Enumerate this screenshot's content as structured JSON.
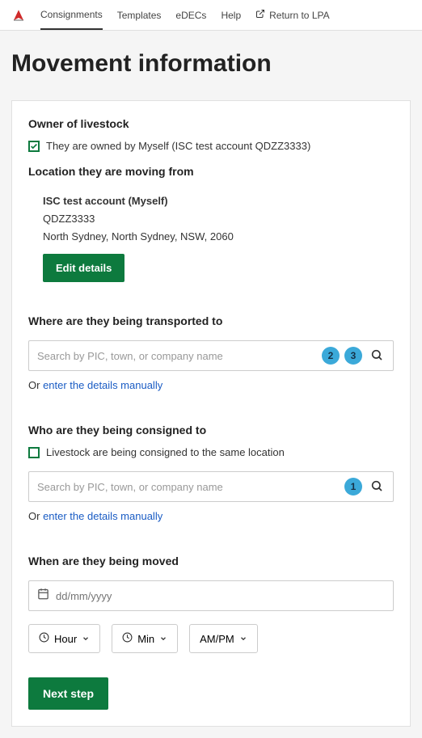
{
  "nav": {
    "consignments": "Consignments",
    "templates": "Templates",
    "edecs": "eDECs",
    "help": "Help",
    "return_lpa": "Return to LPA"
  },
  "page_title": "Movement information",
  "owner": {
    "heading": "Owner of livestock",
    "checkbox_label": "They are owned by Myself (ISC test account QDZZ3333)"
  },
  "moving_from": {
    "heading": "Location they are moving from",
    "account": "ISC test account (Myself)",
    "pic": "QDZZ3333",
    "address": "North Sydney, North Sydney, NSW, 2060",
    "edit_btn": "Edit details"
  },
  "transported_to": {
    "heading": "Where are they being transported to",
    "placeholder": "Search by PIC, town, or company name",
    "badge2": "2",
    "badge3": "3",
    "or_text": "Or ",
    "link": "enter the details manually"
  },
  "consigned_to": {
    "heading": "Who are they being consigned to",
    "checkbox_label": "Livestock are being consigned to the same location",
    "placeholder": "Search by PIC, town, or company name",
    "badge1": "1",
    "or_text": "Or ",
    "link": "enter the details manually"
  },
  "when_moved": {
    "heading": "When are they being moved",
    "date_placeholder": "dd/mm/yyyy",
    "hour": "Hour",
    "min": "Min",
    "ampm": "AM/PM"
  },
  "next_btn": "Next step"
}
